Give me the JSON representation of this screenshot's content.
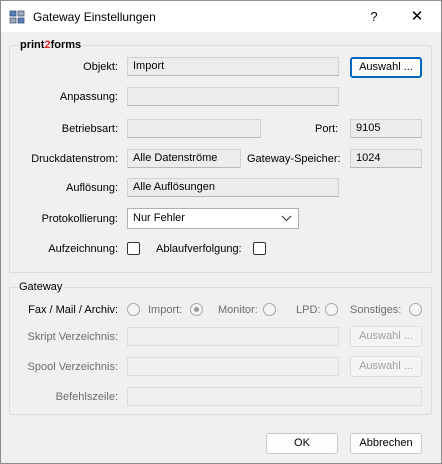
{
  "window": {
    "title": "Gateway Einstellungen",
    "help_glyph": "?",
    "close_glyph": "✕"
  },
  "settings": {
    "brand_prefix": "print",
    "brand_accent": "2",
    "brand_suffix": "forms",
    "brand_accent_color": "#d92b2b",
    "objekt_label": "Objekt:",
    "objekt_value": "Import",
    "auswahl_button": "Auswahl ...",
    "anpassung_label": "Anpassung:",
    "anpassung_value": "",
    "betriebsart_label": "Betriebsart:",
    "betriebsart_value": "",
    "port_label": "Port:",
    "port_value": "9105",
    "druckdatenstrom_label": "Druckdatenstrom:",
    "druckdatenstrom_value": "Alle Datenströme",
    "speicher_label": "Gateway-Speicher:",
    "speicher_value": "1024",
    "aufloesung_label": "Auflösung:",
    "aufloesung_value": "Alle Auflösungen",
    "protokollierung_label": "Protokollierung:",
    "protokollierung_value": "Nur Fehler",
    "aufzeichnung_label": "Aufzeichnung:",
    "aufzeichnung_checked": false,
    "ablaufverfolgung_label": "Ablaufverfolgung:",
    "ablaufverfolgung_checked": false
  },
  "gateway": {
    "group_title": "Gateway",
    "type_label": "Fax / Mail / Archiv:",
    "options": [
      {
        "label": "Import:",
        "selected": true
      },
      {
        "label": "Monitor:",
        "selected": false
      },
      {
        "label": "LPD:",
        "selected": false
      },
      {
        "label": "Sonstiges:",
        "selected": false
      }
    ],
    "skript_label": "Skript Verzeichnis:",
    "skript_value": "",
    "skript_button": "Auswahl ...",
    "spool_label": "Spool Verzeichnis:",
    "spool_value": "",
    "spool_button": "Auswahl ...",
    "befehlszeile_label": "Befehlszeile:",
    "befehlszeile_value": ""
  },
  "footer": {
    "ok_label": "OK",
    "cancel_label": "Abbrechen"
  }
}
